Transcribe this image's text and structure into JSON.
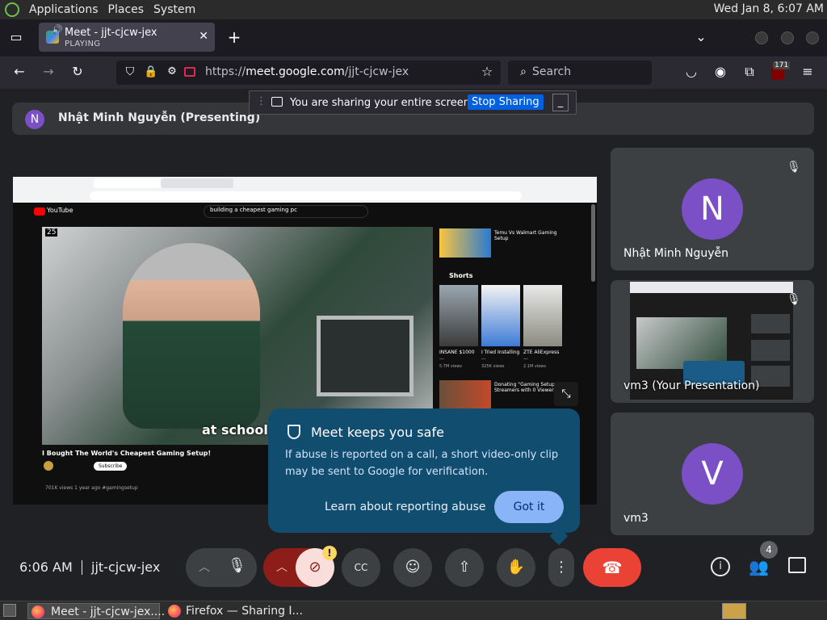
{
  "gnome": {
    "menus": [
      "Applications",
      "Places",
      "System"
    ],
    "clock": "Wed Jan  8,  6:07 AM"
  },
  "browser": {
    "tab": {
      "title": "Meet - jjt-cjcw-jex",
      "status": "PLAYING"
    },
    "url_prefix": "https://",
    "url_domain": "meet.google.com",
    "url_path": "/jjt-cjcw-jex",
    "search_placeholder": "Search",
    "extension_badge": "171"
  },
  "share_notice": {
    "text": "You are sharing your entire screen.",
    "stop_label": "Stop Sharing"
  },
  "meet": {
    "presenter_initial": "N",
    "presenter_label": "Nhật Minh Nguyễn (Presenting)",
    "participants": [
      {
        "initial": "N",
        "name": "Nhật Minh Nguyễn",
        "color": "#7b4fc6"
      },
      {
        "name": "vm3 (Your Presentation)"
      },
      {
        "initial": "V",
        "name": "vm3",
        "color": "#7b4fc6"
      }
    ],
    "shared_screen": {
      "search_query": "building a cheapest gaming pc",
      "video_title": "I Bought The World's Cheapest Gaming Setup!",
      "caption": "at school",
      "subscribe": "Subscribe",
      "counter": "25",
      "sidebar_video_title": "Temu Vs Walmart Gaming Setup",
      "shorts_label": "Shorts",
      "short_labels": [
        "INSANE $1000 ...",
        "I Tried Installing ...",
        "ZTE AliExpress ..."
      ],
      "short_views": [
        "5.7M views",
        "325K views",
        "2.1M views"
      ],
      "bottom_video_title": "Donating \"Gaming Setups\" to Streamers with 0 Viewers",
      "views_line": "701K views  1 year ago  #gamingsetup"
    },
    "popup": {
      "title": "Meet keeps you safe",
      "body": "If abuse is reported on a call, a short video-only clip may be sent to Google for verification.",
      "link_label": "Learn about reporting abuse",
      "button_label": "Got it"
    },
    "bottom_bar": {
      "time": "6:06 AM",
      "meeting_code": "jjt-cjcw-jex",
      "people_count": "4"
    }
  },
  "taskbar": {
    "items": [
      "Meet - jjt-cjcw-jex....",
      "Firefox — Sharing I..."
    ]
  },
  "colors": {
    "meet_bg": "#202124",
    "tile_bg": "#3c4043",
    "avatar": "#7b4fc6",
    "end_call": "#ea4335",
    "popup_bg": "#114d6e",
    "popup_button": "#8ab4f8",
    "stop_button": "#0060df"
  }
}
